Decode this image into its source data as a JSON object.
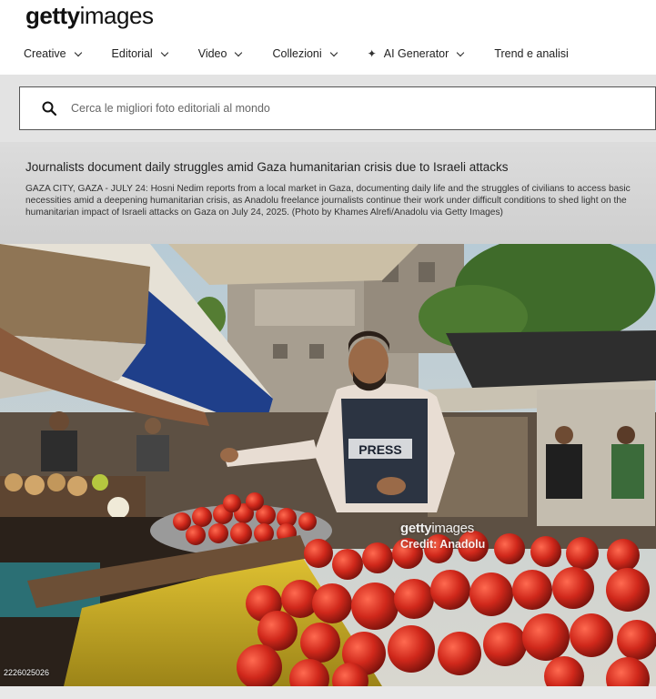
{
  "brand": {
    "logo_bold": "getty",
    "logo_light": "images"
  },
  "nav": {
    "items": [
      {
        "label": "Creative",
        "has_chevron": true
      },
      {
        "label": "Editorial",
        "has_chevron": true
      },
      {
        "label": "Video",
        "has_chevron": true
      },
      {
        "label": "Collezioni",
        "has_chevron": true
      },
      {
        "label": "AI Generator",
        "has_chevron": true,
        "icon": "sparkle-icon"
      },
      {
        "label": "Trend e analisi",
        "has_chevron": false
      }
    ]
  },
  "search": {
    "placeholder": "Cerca le migliori foto editoriali al mondo",
    "icon": "search-icon"
  },
  "caption": {
    "title": "Journalists document daily struggles amid Gaza humanitarian crisis due to Israeli attacks",
    "body": "GAZA CITY, GAZA - JULY 24: Hosni Nedim reports from a local market in Gaza, documenting daily life and the struggles of civilians to access basic necessities amid a deepening humanitarian crisis, as Anadolu freelance journalists continue their work under difficult conditions to shed light on the humanitarian impact of Israeli attacks on Gaza on July 24, 2025. (Photo by Khames Alrefi/Anadolu via Getty Images)"
  },
  "photo": {
    "vest_label": "PRESS",
    "watermark_logo_bold": "getty",
    "watermark_logo_light": "images",
    "watermark_credit": "Credit: Anadolu",
    "image_id": "2226025026"
  },
  "colors": {
    "search_band": "#e3e3e3",
    "tomato": "#c8241a",
    "umbrella_blue": "#1f3f8a"
  }
}
